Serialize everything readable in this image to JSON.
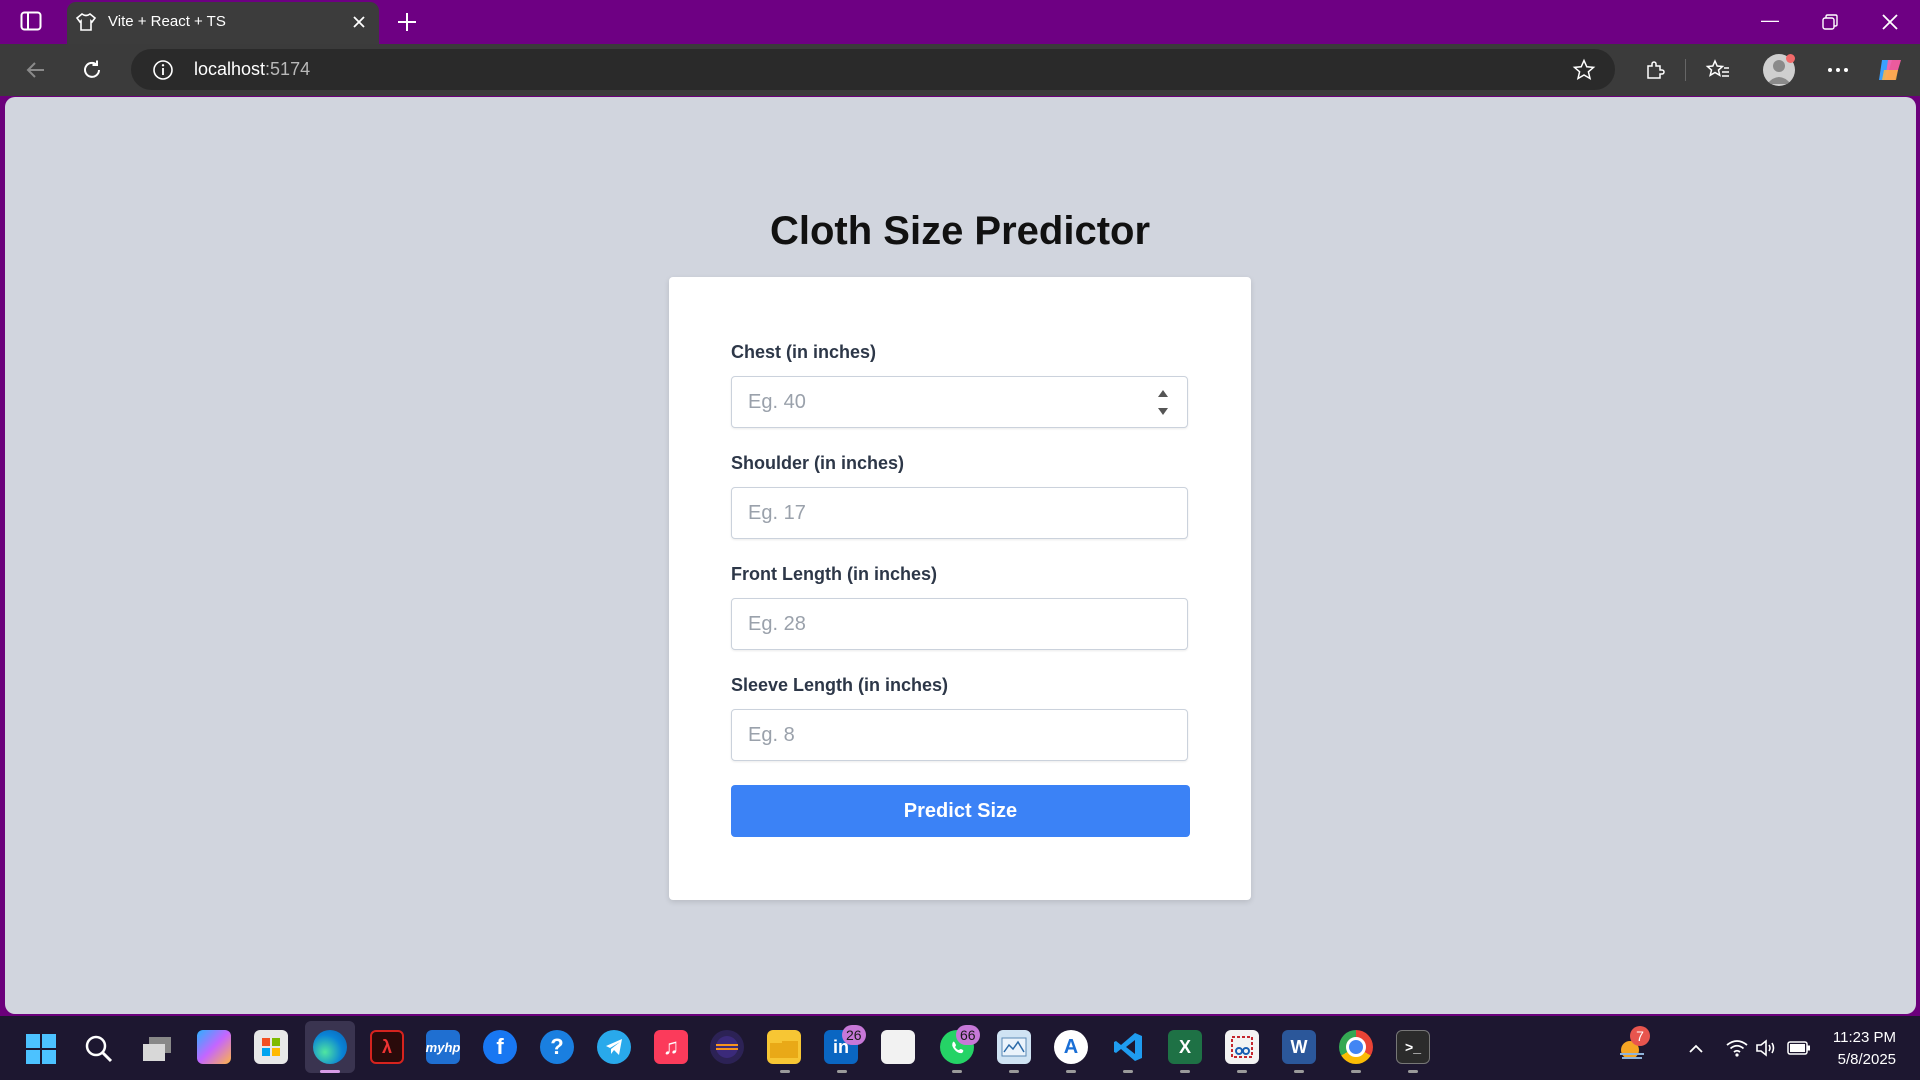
{
  "browser": {
    "tab_title": "Vite + React + TS",
    "url_host": "localhost",
    "url_port": ":5174"
  },
  "page": {
    "title": "Cloth Size Predictor",
    "fields": [
      {
        "label": "Chest (in inches)",
        "placeholder": "Eg. 40",
        "value": ""
      },
      {
        "label": "Shoulder (in inches)",
        "placeholder": "Eg. 17",
        "value": ""
      },
      {
        "label": "Front Length (in inches)",
        "placeholder": "Eg. 28",
        "value": ""
      },
      {
        "label": "Sleeve Length (in inches)",
        "placeholder": "Eg. 8",
        "value": ""
      }
    ],
    "submit_label": "Predict Size",
    "accent_color": "#3b82f6"
  },
  "taskbar": {
    "badges": {
      "linkedin": "26",
      "whatsapp": "66",
      "weather": "7"
    },
    "time": "11:23 PM",
    "date": "5/8/2025"
  }
}
